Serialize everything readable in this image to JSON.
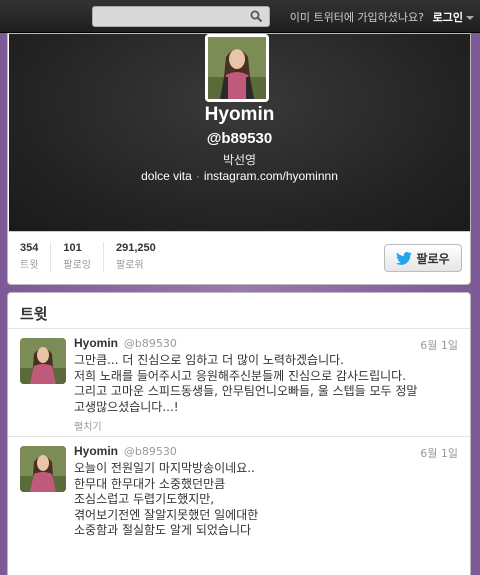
{
  "topbar": {
    "search_placeholder": "",
    "signup_prompt": "이미 트위터에 가입하셨나요?",
    "login_label": "로그인"
  },
  "profile": {
    "fullname": "Hyomin",
    "screen_name": "@b89530",
    "real_name": "박선영",
    "bio": "dolce vita",
    "url": "instagram.com/hyominnn",
    "stats": [
      {
        "count": "354",
        "label": "트윗"
      },
      {
        "count": "101",
        "label": "팔로잉"
      },
      {
        "count": "291,250",
        "label": "팔로워"
      }
    ],
    "follow_label": "팔로우"
  },
  "timeline": {
    "title": "트윗",
    "tweets": [
      {
        "name": "Hyomin",
        "handle": "@b89530",
        "date": "6월 1일",
        "text": "그만큼... 더 진심으로 임하고 더 많이 노력하겠습니다.\n저희 노래를 들어주시고 응원해주신분들께 진심으로  감사드립니다.\n그리고 고마운 스피드동생들, 안무팀언니오빠들, 울 스텝들 모두 정말\n고생많으셨습니다...!",
        "expand": "펼치기"
      },
      {
        "name": "Hyomin",
        "handle": "@b89530",
        "date": "6월 1일",
        "text": "오늘이 전원일기 마지막방송이네요..\n한무대 한무대가 소중했던만큼\n조심스럽고 두렵기도했지만,\n겪어보기전엔 잘알지못했던 일에대한\n 소중함과 절실함도 알게 되었습니다",
        "expand": ""
      }
    ]
  }
}
